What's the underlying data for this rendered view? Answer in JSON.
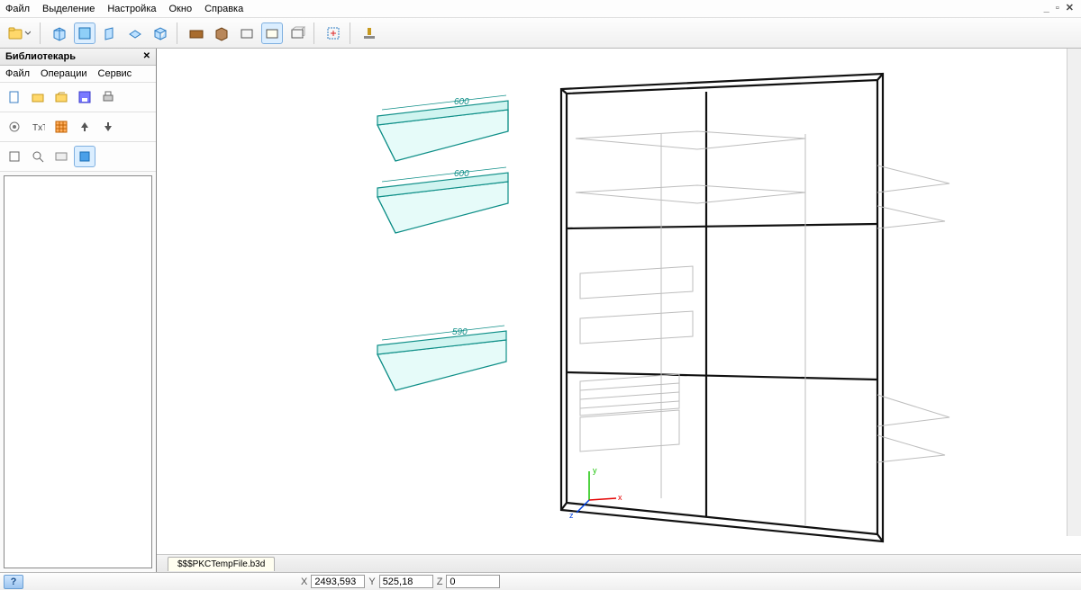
{
  "menu": {
    "items": [
      "Файл",
      "Выделение",
      "Настройка",
      "Окно",
      "Справка"
    ]
  },
  "window_controls": "_ ▫ ✕",
  "side": {
    "title": "Библиотекарь",
    "close": "✕",
    "submenu": [
      "Файл",
      "Операции",
      "Сервис"
    ]
  },
  "tab_label": "$$$PKCTempFile.b3d",
  "coords": {
    "x_label": "X",
    "x_value": "2493,593",
    "y_label": "Y",
    "y_value": "525,18",
    "z_label": "Z",
    "z_value": "0"
  },
  "help_label": "?",
  "dims": {
    "d1": "600",
    "d2": "600",
    "d3": "590"
  },
  "axes": {
    "y": "y",
    "x": "x",
    "z": "z"
  },
  "icons": {
    "folder": "folder-icon",
    "cube_blue": "cube-icon",
    "cube_wire": "wireframe-icon",
    "box_brown": "material-icon",
    "rect": "rect-icon",
    "cross": "selection-icon",
    "pedestal": "stand-icon",
    "new_doc": "new-file-icon",
    "open": "open-icon",
    "save": "save-icon",
    "print": "print-icon",
    "settings": "settings-icon",
    "text": "text-icon",
    "grid": "grid-icon",
    "up": "up-arrow-icon",
    "down": "down-arrow-icon",
    "misc1": "tool-icon",
    "misc2": "lens-icon",
    "misc3": "panel-icon",
    "blue_sq": "blue-square-icon"
  }
}
